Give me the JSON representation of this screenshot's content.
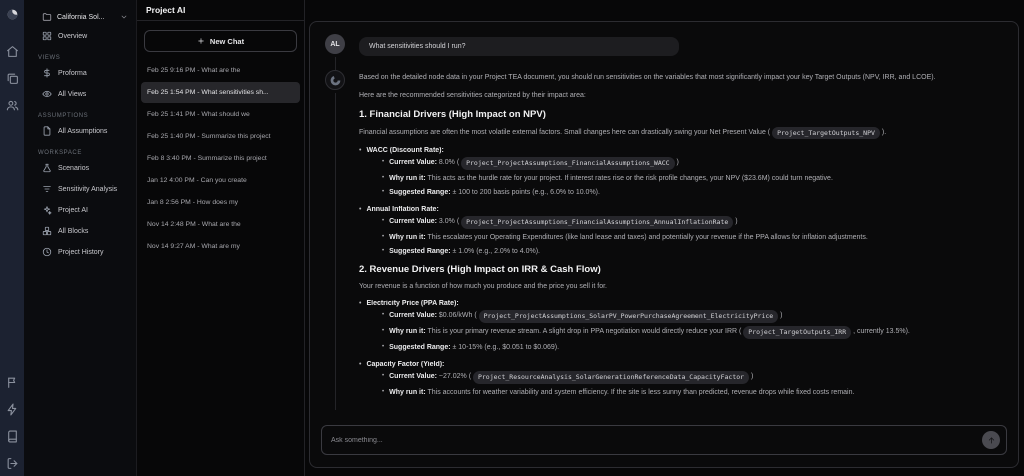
{
  "colors": {
    "rail_bg": "#1c2231",
    "selected_item_bg": "#27272b",
    "chip_bg": "#26262b",
    "card_border": "#2c2c31",
    "user_bubble_bg": "#1d1d20"
  },
  "rail": {
    "logo_icon": "logo",
    "top_icons": [
      {
        "icon": "home",
        "name": "home-icon"
      },
      {
        "icon": "layers",
        "name": "layers-icon"
      },
      {
        "icon": "users",
        "name": "users-icon"
      }
    ],
    "bottom_icons": [
      {
        "icon": "flag",
        "name": "flag-icon"
      },
      {
        "icon": "zap",
        "name": "zap-icon"
      },
      {
        "icon": "book",
        "name": "book-icon"
      },
      {
        "icon": "logout",
        "name": "logout-icon"
      }
    ]
  },
  "sidebar": {
    "project_selector": {
      "label": "California Sol...",
      "icon": "folder",
      "chevron_icon": "chevron-down"
    },
    "sections": [
      {
        "label": null,
        "items": [
          {
            "icon": "grid",
            "label": "Overview"
          }
        ]
      },
      {
        "label": "VIEWS",
        "items": [
          {
            "icon": "dollar",
            "label": "Proforma"
          },
          {
            "icon": "eye",
            "label": "All Views"
          }
        ]
      },
      {
        "label": "ASSUMPTIONS",
        "items": [
          {
            "icon": "document",
            "label": "All Assumptions"
          }
        ]
      },
      {
        "label": "WORKSPACE",
        "items": [
          {
            "icon": "flask",
            "label": "Scenarios"
          },
          {
            "icon": "filter",
            "label": "Sensitivity Analysis"
          },
          {
            "icon": "sparkles",
            "label": "Project AI"
          },
          {
            "icon": "blocks",
            "label": "All Blocks"
          },
          {
            "icon": "clock",
            "label": "Project History"
          }
        ]
      }
    ]
  },
  "chat_panel": {
    "title": "Project AI",
    "new_chat_label": "New Chat",
    "new_chat_icon": "plus",
    "history": [
      {
        "label": "Feb 25 9:16 PM - What are the",
        "selected": false
      },
      {
        "label": "Feb 25 1:54 PM - What sensitivities sh...",
        "selected": true
      },
      {
        "label": "Feb 25 1:41 PM - What should we",
        "selected": false
      },
      {
        "label": "Feb 25 1:40 PM - Summarize this project",
        "selected": false
      },
      {
        "label": "Feb 8 3:40 PM - Summarize this project",
        "selected": false
      },
      {
        "label": "Jan 12 4:00 PM - Can you create",
        "selected": false
      },
      {
        "label": "Jan 8 2:56 PM - How does my",
        "selected": false
      },
      {
        "label": "Nov 14 2:48 PM - What are the",
        "selected": false
      },
      {
        "label": "Nov 14 9:27 AM - What are my",
        "selected": false
      }
    ]
  },
  "conversation": {
    "user": {
      "avatar_initials": "AL",
      "message": "What sensitivities should I run?"
    },
    "assistant": {
      "avatar_icon": "ai-logo",
      "blocks": [
        {
          "type": "p",
          "seg": [
            {
              "t": "Based on the detailed node data in your Project TEA document, you should run sensitivities on the variables that most significantly impact your key Target Outputs (NPV, IRR, and LCOE)."
            }
          ]
        },
        {
          "type": "p",
          "seg": [
            {
              "t": "Here are the recommended sensitivities categorized by their impact area:"
            }
          ]
        },
        {
          "type": "h3",
          "text": "1. Financial Drivers (High Impact on NPV)"
        },
        {
          "type": "p",
          "seg": [
            {
              "t": "Financial assumptions are often the most volatile external factors. Small changes here can drastically swing your Net Present Value ( "
            },
            {
              "c": "Project_TargetOutputs_NPV"
            },
            {
              "t": " )."
            }
          ]
        },
        {
          "type": "list",
          "items": [
            {
              "title": [
                {
                  "b": "WACC (Discount Rate):"
                }
              ],
              "sub": [
                [
                  {
                    "b": "Current Value:"
                  },
                  {
                    "t": " 8.0% ( "
                  },
                  {
                    "c": "Project_ProjectAssumptions_FinancialAssumptions_WACC"
                  },
                  {
                    "t": " )"
                  }
                ],
                [
                  {
                    "b": "Why run it:"
                  },
                  {
                    "t": " This acts as the hurdle rate for your project. If interest rates rise or the risk profile changes, your NPV ($23.6M) could turn negative."
                  }
                ],
                [
                  {
                    "b": "Suggested Range:"
                  },
                  {
                    "t": " ± 100 to 200 basis points (e.g., 6.0% to 10.0%)."
                  }
                ]
              ]
            },
            {
              "title": [
                {
                  "b": "Annual Inflation Rate:"
                }
              ],
              "sub": [
                [
                  {
                    "b": "Current Value:"
                  },
                  {
                    "t": " 3.0% ( "
                  },
                  {
                    "c": "Project_ProjectAssumptions_FinancialAssumptions_AnnualInflationRate"
                  },
                  {
                    "t": " )"
                  }
                ],
                [
                  {
                    "b": "Why run it:"
                  },
                  {
                    "t": " This escalates your Operating Expenditures (like land lease and taxes) and potentially your revenue if the PPA allows for inflation adjustments."
                  }
                ],
                [
                  {
                    "b": "Suggested Range:"
                  },
                  {
                    "t": " ± 1.0% (e.g., 2.0% to 4.0%)."
                  }
                ]
              ]
            }
          ]
        },
        {
          "type": "h3",
          "text": "2. Revenue Drivers (High Impact on IRR & Cash Flow)"
        },
        {
          "type": "p",
          "seg": [
            {
              "t": "Your revenue is a function of how much you produce and the price you sell it for."
            }
          ]
        },
        {
          "type": "list",
          "items": [
            {
              "title": [
                {
                  "b": "Electricity Price (PPA Rate):"
                }
              ],
              "sub": [
                [
                  {
                    "b": "Current Value:"
                  },
                  {
                    "t": " $0.06/kWh ( "
                  },
                  {
                    "c": "Project_ProjectAssumptions_SolarPV_PowerPurchaseAgreement_ElectricityPrice"
                  },
                  {
                    "t": " )"
                  }
                ],
                [
                  {
                    "b": "Why run it:"
                  },
                  {
                    "t": " This is your primary revenue stream. A slight drop in PPA negotiation would directly reduce your IRR ( "
                  },
                  {
                    "c": "Project_TargetOutputs_IRR"
                  },
                  {
                    "t": " , currently 13.5%)."
                  }
                ],
                [
                  {
                    "b": "Suggested Range:"
                  },
                  {
                    "t": " ± 10-15% (e.g., $0.051 to $0.069)."
                  }
                ]
              ]
            },
            {
              "title": [
                {
                  "b": "Capacity Factor (Yield):"
                }
              ],
              "sub": [
                [
                  {
                    "b": "Current Value:"
                  },
                  {
                    "t": " ~27.02% ( "
                  },
                  {
                    "c": "Project_ResourceAnalysis_SolarGenerationReferenceData_CapacityFactor"
                  },
                  {
                    "t": " )"
                  }
                ],
                [
                  {
                    "b": "Why run it:"
                  },
                  {
                    "t": " This accounts for weather variability and system efficiency. If the site is less sunny than predicted, revenue drops while fixed costs remain."
                  }
                ]
              ]
            }
          ]
        }
      ]
    }
  },
  "composer": {
    "placeholder": "Ask something...",
    "send_icon": "arrow-up"
  }
}
